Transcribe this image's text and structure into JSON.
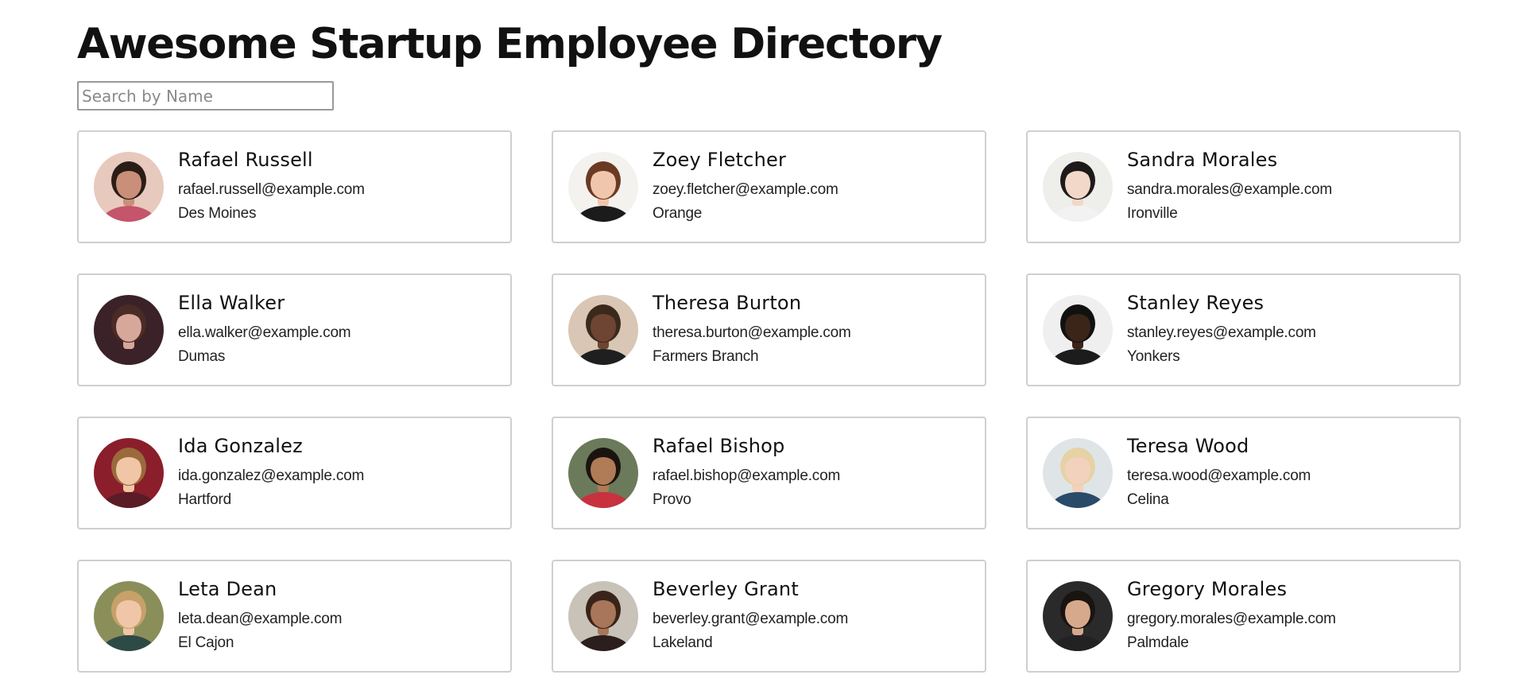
{
  "header": {
    "title": "Awesome Startup Employee Directory"
  },
  "search": {
    "placeholder": "Search by Name",
    "value": ""
  },
  "employees": [
    {
      "name": "Rafael Russell",
      "email": "rafael.russell@example.com",
      "city": "Des Moines",
      "avatar_colors": {
        "bg": "#e8c9bd",
        "skin": "#c98f78",
        "hair": "#2a1d18",
        "shirt": "#c4556b"
      }
    },
    {
      "name": "Zoey Fletcher",
      "email": "zoey.fletcher@example.com",
      "city": "Orange",
      "avatar_colors": {
        "bg": "#f4f2ef",
        "skin": "#f0c7ad",
        "hair": "#6b3a22",
        "shirt": "#1b1b1b"
      }
    },
    {
      "name": "Sandra Morales",
      "email": "sandra.morales@example.com",
      "city": "Ironville",
      "avatar_colors": {
        "bg": "#eeeeea",
        "skin": "#f1d8c8",
        "hair": "#1e1a1a",
        "shirt": "#f2f2f2"
      }
    },
    {
      "name": "Ella Walker",
      "email": "ella.walker@example.com",
      "city": "Dumas",
      "avatar_colors": {
        "bg": "#3a2228",
        "skin": "#d7a79a",
        "hair": "#4a2b25",
        "shirt": "#3a2228"
      }
    },
    {
      "name": "Theresa Burton",
      "email": "theresa.burton@example.com",
      "city": "Farmers Branch",
      "avatar_colors": {
        "bg": "#d9c6b5",
        "skin": "#6e4432",
        "hair": "#3b2a1c",
        "shirt": "#1f1f1f"
      }
    },
    {
      "name": "Stanley Reyes",
      "email": "stanley.reyes@example.com",
      "city": "Yonkers",
      "avatar_colors": {
        "bg": "#efefef",
        "skin": "#3b2418",
        "hair": "#111111",
        "shirt": "#1c1c1c"
      }
    },
    {
      "name": "Ida Gonzalez",
      "email": "ida.gonzalez@example.com",
      "city": "Hartford",
      "avatar_colors": {
        "bg": "#8b1e2b",
        "skin": "#f0c6a6",
        "hair": "#9a6a3c",
        "shirt": "#5a1c26"
      }
    },
    {
      "name": "Rafael Bishop",
      "email": "rafael.bishop@example.com",
      "city": "Provo",
      "avatar_colors": {
        "bg": "#6b7a5a",
        "skin": "#b07b57",
        "hair": "#1a1410",
        "shirt": "#c8323f"
      }
    },
    {
      "name": "Teresa Wood",
      "email": "teresa.wood@example.com",
      "city": "Celina",
      "avatar_colors": {
        "bg": "#dfe5e6",
        "skin": "#f2d1bd",
        "hair": "#e6d2a4",
        "shirt": "#2a4a6a"
      }
    },
    {
      "name": "Leta Dean",
      "email": "leta.dean@example.com",
      "city": "El Cajon",
      "avatar_colors": {
        "bg": "#8a8f5a",
        "skin": "#efc7a8",
        "hair": "#c8a06a",
        "shirt": "#2e4a46"
      }
    },
    {
      "name": "Beverley Grant",
      "email": "beverley.grant@example.com",
      "city": "Lakeland",
      "avatar_colors": {
        "bg": "#c9c2b8",
        "skin": "#a8765a",
        "hair": "#3a241a",
        "shirt": "#2a1f1c"
      }
    },
    {
      "name": "Gregory Morales",
      "email": "gregory.morales@example.com",
      "city": "Palmdale",
      "avatar_colors": {
        "bg": "#2a2a2a",
        "skin": "#d7a98c",
        "hair": "#1a1411",
        "shirt": "#222222"
      }
    }
  ]
}
